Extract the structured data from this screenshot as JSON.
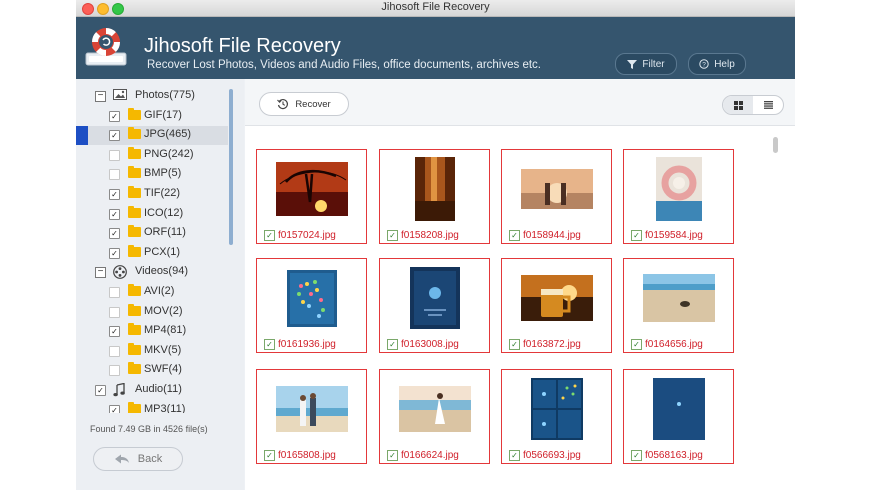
{
  "window": {
    "title": "Jihosoft File Recovery"
  },
  "header": {
    "app_title": "Jihosoft File Recovery",
    "subtitle": "Recover Lost Photos, Videos and Audio Files, office documents, archives etc.",
    "filter_label": "Filter",
    "help_label": "Help"
  },
  "tree": [
    {
      "label": "Photos(775)",
      "level": 0,
      "icon": "photos-icon",
      "expander": "minus",
      "checked": null
    },
    {
      "label": "GIF(17)",
      "level": 1,
      "icon": "folder-icon",
      "checked": true
    },
    {
      "label": "JPG(465)",
      "level": 1,
      "icon": "folder-icon",
      "checked": true,
      "selected": true
    },
    {
      "label": "PNG(242)",
      "level": 1,
      "icon": "folder-icon",
      "checked": false
    },
    {
      "label": "BMP(5)",
      "level": 1,
      "icon": "folder-icon",
      "checked": false
    },
    {
      "label": "TIF(22)",
      "level": 1,
      "icon": "folder-icon",
      "checked": true
    },
    {
      "label": "ICO(12)",
      "level": 1,
      "icon": "folder-icon",
      "checked": true
    },
    {
      "label": "ORF(11)",
      "level": 1,
      "icon": "folder-icon",
      "checked": true
    },
    {
      "label": "PCX(1)",
      "level": 1,
      "icon": "folder-icon",
      "checked": true
    },
    {
      "label": "Videos(94)",
      "level": 0,
      "icon": "film-reel-icon",
      "expander": "minus",
      "checked": null
    },
    {
      "label": "AVI(2)",
      "level": 1,
      "icon": "folder-icon",
      "checked": false
    },
    {
      "label": "MOV(2)",
      "level": 1,
      "icon": "folder-icon",
      "checked": false
    },
    {
      "label": "MP4(81)",
      "level": 1,
      "icon": "folder-icon",
      "checked": true
    },
    {
      "label": "MKV(5)",
      "level": 1,
      "icon": "folder-icon",
      "checked": false
    },
    {
      "label": "SWF(4)",
      "level": 1,
      "icon": "folder-icon",
      "checked": false
    },
    {
      "label": "Audio(11)",
      "level": 0,
      "icon": "music-note-icon",
      "checked": true
    },
    {
      "label": "MP3(11)",
      "level": 1,
      "icon": "folder-icon",
      "checked": true
    }
  ],
  "status": {
    "found_text": "Found 7.49 GB in 4526 file(s)"
  },
  "buttons": {
    "back_label": "Back",
    "recover_label": "Recover"
  },
  "view": {
    "mode": "grid"
  },
  "files": [
    {
      "name": "f0157024.jpg",
      "checked": true,
      "thumb": "sunset-tree"
    },
    {
      "name": "f0158208.jpg",
      "checked": true,
      "thumb": "autumn-forest"
    },
    {
      "name": "f0158944.jpg",
      "checked": true,
      "thumb": "couple-sunset"
    },
    {
      "name": "f0159584.jpg",
      "checked": true,
      "thumb": "flower-wreath"
    },
    {
      "name": "f0161936.jpg",
      "checked": true,
      "thumb": "game-screen"
    },
    {
      "name": "f0163008.jpg",
      "checked": true,
      "thumb": "dark-app"
    },
    {
      "name": "f0163872.jpg",
      "checked": true,
      "thumb": "beer-sunset"
    },
    {
      "name": "f0164656.jpg",
      "checked": true,
      "thumb": "beach-turtle"
    },
    {
      "name": "f0165808.jpg",
      "checked": true,
      "thumb": "couple-beach"
    },
    {
      "name": "f0166624.jpg",
      "checked": true,
      "thumb": "woman-beach"
    },
    {
      "name": "f0566693.jpg",
      "checked": true,
      "thumb": "app-screens"
    },
    {
      "name": "f0568163.jpg",
      "checked": true,
      "thumb": "blue-screen"
    }
  ]
}
